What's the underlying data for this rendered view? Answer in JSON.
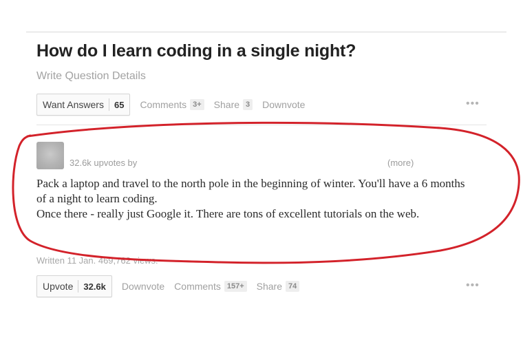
{
  "question": {
    "title": "How do I learn coding in a single night?",
    "details_link": "Write Question Details",
    "want_answers_label": "Want Answers",
    "want_answers_count": "65",
    "comments_label": "Comments",
    "comments_count": "3+",
    "share_label": "Share",
    "share_count": "3",
    "downvote_label": "Downvote",
    "more_menu": "•••"
  },
  "answer": {
    "upvotes_by": "32.6k upvotes by",
    "more_link": "(more)",
    "paragraphs": [
      "Pack a laptop and travel to the north pole in the beginning of winter. You'll have a 6 months of a night to learn coding.",
      "Once there - really just Google it. There are tons of excellent tutorials on the web."
    ],
    "meta": "Written 11 Jan. 469,762 views.",
    "upvote_label": "Upvote",
    "upvote_count": "32.6k",
    "downvote_label": "Downvote",
    "comments_label": "Comments",
    "comments_count": "157+",
    "share_label": "Share",
    "share_count": "74",
    "more_menu": "•••"
  },
  "annotation": {
    "color": "#d3222a"
  },
  "icons": {
    "avatar": "user-avatar-placeholder",
    "more": "more-options-dots-icon"
  }
}
